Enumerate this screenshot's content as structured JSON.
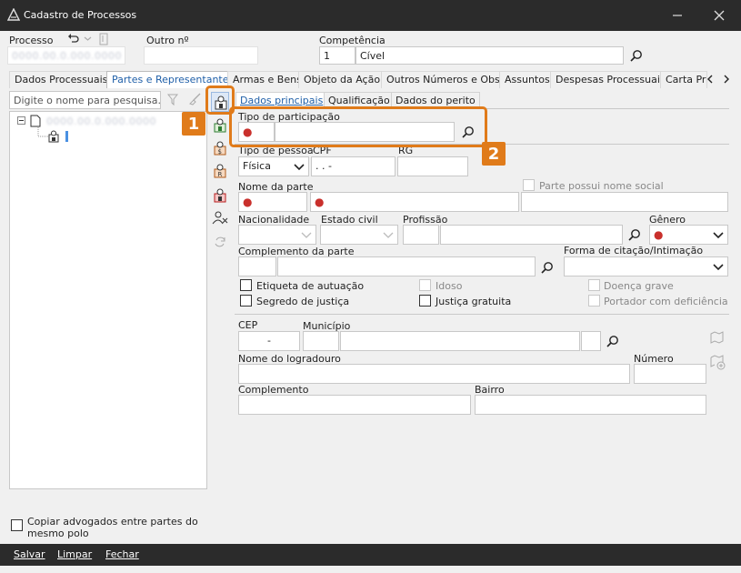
{
  "window": {
    "title": "Cadastro de Processos"
  },
  "header": {
    "processo_label": "Processo",
    "outro_label": "Outro nº",
    "competencia_label": "Competência",
    "competencia_code": "1",
    "competencia_value": "Cível",
    "processo_value": "0000.00.0.000.0000"
  },
  "tabs": [
    "Dados Processuais",
    "Partes e Representantes",
    "Armas e Bens",
    "Objeto da Ação",
    "Outros Números e Obs.",
    "Assuntos",
    "Despesas Processuais",
    "Carta Pr"
  ],
  "left": {
    "search_placeholder": "Digite o nome para pesquisa...",
    "tree_root_label": "0000.00.0.000.0000",
    "copy_lawyers_label": "Copiar advogados entre partes do mesmo polo"
  },
  "subtabs": [
    "Dados principais",
    "Qualificação",
    "Dados do perito"
  ],
  "form": {
    "tipo_participacao_label": "Tipo de participação",
    "tipo_pessoa_label": "Tipo de pessoa",
    "tipo_pessoa_value": "Física",
    "cpf_label": "CPF",
    "cpf_mask": " .  .  -",
    "rg_label": "RG",
    "nome_parte_label": "Nome da parte",
    "nome_social_label": "Parte possui nome social",
    "nacionalidade_label": "Nacionalidade",
    "estado_civil_label": "Estado civil",
    "profissao_label": "Profissão",
    "genero_label": "Gênero",
    "complemento_parte_label": "Complemento da parte",
    "forma_citacao_label": "Forma de citação/Intimação",
    "etiqueta_label": "Etiqueta de autuação",
    "segredo_label": "Segredo de justiça",
    "idoso_label": "Idoso",
    "justica_gratuita_label": "Justiça gratuita",
    "doenca_grave_label": "Doença grave",
    "portador_label": "Portador com deficiência",
    "cep_label": "CEP",
    "cep_mask": "-",
    "municipio_label": "Município",
    "logradouro_label": "Nome do logradouro",
    "numero_label": "Número",
    "complemento_label": "Complemento",
    "bairro_label": "Bairro",
    "required_mark": "●"
  },
  "callouts": {
    "one": "1",
    "two": "2"
  },
  "footer": {
    "save": "Salvar",
    "clear": "Limpar",
    "close": "Fechar"
  },
  "icons": [
    "app-icon",
    "undo-icon",
    "attach-icon",
    "search-icon",
    "filter-icon",
    "broom-icon",
    "person-add-icon",
    "person-lawyer-icon",
    "person-dollar-icon",
    "person-r-icon",
    "person-lock-icon",
    "person-remove-icon",
    "swap-icon",
    "map-icon",
    "minimize-icon",
    "close-icon"
  ]
}
